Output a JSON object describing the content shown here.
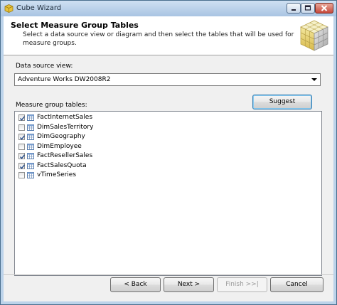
{
  "window": {
    "title": "Cube Wizard"
  },
  "header": {
    "title": "Select Measure Group Tables",
    "description": "Select a data source view or diagram and then select the tables that will be used for measure groups."
  },
  "data_source": {
    "label": "Data source view:",
    "selected": "Adventure Works DW2008R2"
  },
  "measure_group": {
    "label": "Measure group tables:",
    "suggest_label": "Suggest",
    "tables": [
      {
        "name": "FactInternetSales",
        "checked": true
      },
      {
        "name": "DimSalesTerritory",
        "checked": false
      },
      {
        "name": "DimGeography",
        "checked": true
      },
      {
        "name": "DimEmployee",
        "checked": false
      },
      {
        "name": "FactResellerSales",
        "checked": true
      },
      {
        "name": "FactSalesQuota",
        "checked": true
      },
      {
        "name": "vTimeSeries",
        "checked": false
      }
    ]
  },
  "buttons": {
    "back": "< Back",
    "next": "Next >",
    "finish": "Finish >>|",
    "cancel": "Cancel"
  },
  "colors": {
    "title_bar": "#bcd3ea",
    "default_button_border": "#3c7fb1",
    "check": "#2b4f8a"
  }
}
